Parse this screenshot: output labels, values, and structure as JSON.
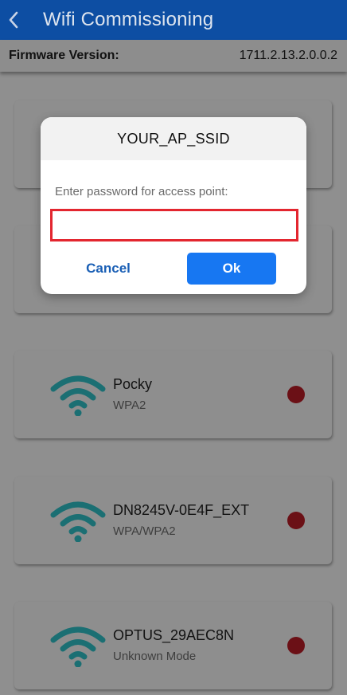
{
  "header": {
    "title": "Wifi Commissioning",
    "back_icon": "chevron-left-icon"
  },
  "firmware": {
    "label": "Firmware Version:",
    "value": "1711.2.13.2.0.0.2"
  },
  "networks": [
    {
      "ssid": "",
      "security": ""
    },
    {
      "ssid": "",
      "security": ""
    },
    {
      "ssid": "Pocky",
      "security": "WPA2"
    },
    {
      "ssid": "DN8245V-0E4F_EXT",
      "security": "WPA/WPA2"
    },
    {
      "ssid": "OPTUS_29AEC8N",
      "security": "Unknown Mode"
    }
  ],
  "dialog": {
    "title": "YOUR_AP_SSID",
    "message": "Enter password for access point:",
    "password_value": "",
    "cancel_label": "Cancel",
    "ok_label": "Ok"
  },
  "colors": {
    "header_bg": "#0d4ea3",
    "wifi_icon": "#1b6f73",
    "status_dot": "#6b1016",
    "ok_button": "#1777f2",
    "input_border": "#e3262f"
  }
}
